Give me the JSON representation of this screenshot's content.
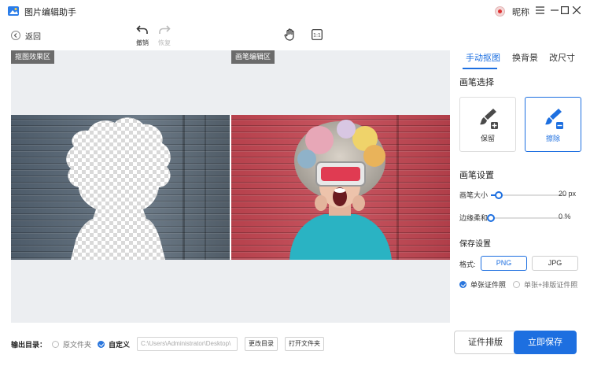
{
  "app": {
    "title": "图片编辑助手",
    "nickname": "昵称"
  },
  "toolbar": {
    "back_label": "返回",
    "undo_label": "撤销",
    "redo_label": "恢复"
  },
  "canvas": {
    "left_tag": "抠图效果区",
    "right_tag": "画笔编辑区"
  },
  "output": {
    "label": "输出目录：",
    "option_original": "原文件夹",
    "option_custom": "自定义",
    "path": "C:\\Users\\Administrator\\Desktop\\",
    "change_btn": "更改目录",
    "open_btn": "打开文件夹"
  },
  "tabs": [
    "手动抠图",
    "换背景",
    "改尺寸"
  ],
  "brush": {
    "title": "画笔选择",
    "keep": "保留",
    "erase": "擦除"
  },
  "brush_settings": {
    "title": "画笔设置",
    "size_label": "画笔大小",
    "size_value": "20 px",
    "size_fraction": 0.1,
    "soft_label": "边缘柔和",
    "soft_value": "0 %",
    "soft_fraction": 0.0
  },
  "save": {
    "title": "保存设置",
    "format_label": "格式:",
    "png": "PNG",
    "jpg": "JPG",
    "single": "单张证件照",
    "single_layout": "单张+排版证件照"
  },
  "actions": {
    "layout": "证件排版",
    "save_now": "立即保存"
  },
  "colors": {
    "accent": "#1d6fe0"
  }
}
